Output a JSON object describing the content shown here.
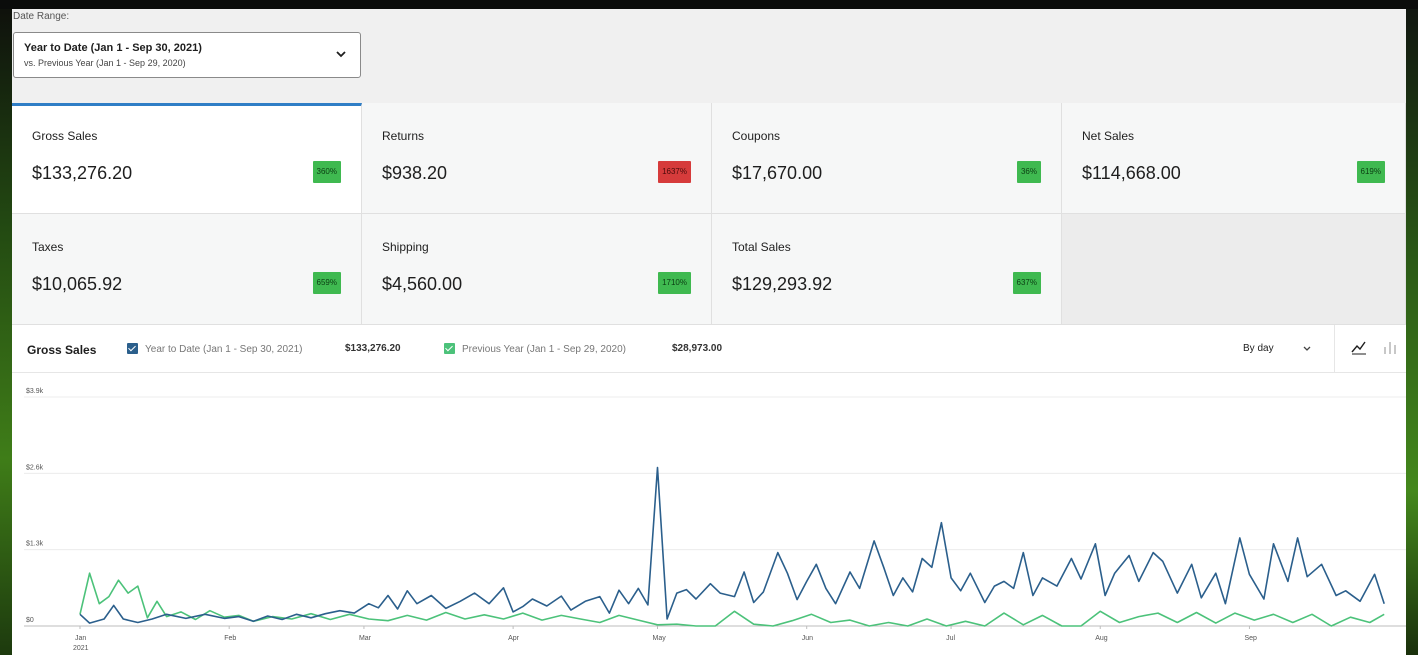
{
  "date_range": {
    "label": "Date Range:",
    "main": "Year to Date (Jan 1 - Sep 30, 2021)",
    "sub": "vs. Previous Year (Jan 1 - Sep 29, 2020)"
  },
  "cards": [
    {
      "label": "Gross Sales",
      "value": "$133,276.20",
      "change": "360%",
      "status": "up",
      "active": true
    },
    {
      "label": "Returns",
      "value": "$938.20",
      "change": "1637%",
      "status": "down"
    },
    {
      "label": "Coupons",
      "value": "$17,670.00",
      "change": "36%",
      "status": "up"
    },
    {
      "label": "Net Sales",
      "value": "$114,668.00",
      "change": "619%",
      "status": "up"
    },
    {
      "label": "Taxes",
      "value": "$10,065.92",
      "change": "659%",
      "status": "up"
    },
    {
      "label": "Shipping",
      "value": "$4,560.00",
      "change": "1710%",
      "status": "up"
    },
    {
      "label": "Total Sales",
      "value": "$129,293.92",
      "change": "637%",
      "status": "up"
    }
  ],
  "colors": {
    "accent": "#2f7ec6",
    "badge_up": "#3fb950",
    "badge_down": "#d63b3b",
    "series_current": "#2b5f8c",
    "series_previous": "#4cc27a"
  },
  "chart_header": {
    "title": "Gross Sales",
    "interval": "By day",
    "legend": [
      {
        "label": "Year to Date (Jan 1 - Sep 30, 2021)",
        "total": "$133,276.20",
        "checked": true
      },
      {
        "label": "Previous Year (Jan 1 - Sep 29, 2020)",
        "total": "$28,973.00",
        "checked": true
      }
    ],
    "icons": [
      "line-chart-icon",
      "bar-chart-icon"
    ]
  },
  "chart_data": {
    "type": "line",
    "y_ticks": [
      "$3.9k",
      "$2.6k",
      "$1.3k",
      "$0"
    ],
    "y_tick_values": [
      3900,
      2600,
      1300,
      0
    ],
    "ylim": [
      0,
      3900
    ],
    "x_ticks": [
      "Jan",
      "Feb",
      "Mar",
      "Apr",
      "May",
      "Jun",
      "Jul",
      "Aug",
      "Sep"
    ],
    "x_tick_sub": "2021",
    "x_tick_days": [
      0,
      31,
      59,
      90,
      120,
      151,
      181,
      212,
      243
    ],
    "x_max_day": 272,
    "grid": true,
    "series": [
      {
        "name": "Year to Date (Jan 1 - Sep 30, 2021)",
        "points": [
          [
            0,
            200
          ],
          [
            2,
            50
          ],
          [
            5,
            120
          ],
          [
            7,
            350
          ],
          [
            9,
            120
          ],
          [
            12,
            60
          ],
          [
            15,
            120
          ],
          [
            18,
            200
          ],
          [
            22,
            130
          ],
          [
            26,
            200
          ],
          [
            30,
            130
          ],
          [
            33,
            160
          ],
          [
            36,
            80
          ],
          [
            39,
            170
          ],
          [
            42,
            110
          ],
          [
            45,
            200
          ],
          [
            48,
            140
          ],
          [
            51,
            210
          ],
          [
            54,
            260
          ],
          [
            57,
            220
          ],
          [
            60,
            380
          ],
          [
            62,
            310
          ],
          [
            64,
            520
          ],
          [
            66,
            290
          ],
          [
            68,
            600
          ],
          [
            70,
            380
          ],
          [
            73,
            520
          ],
          [
            76,
            300
          ],
          [
            79,
            420
          ],
          [
            82,
            560
          ],
          [
            85,
            380
          ],
          [
            88,
            650
          ],
          [
            90,
            240
          ],
          [
            92,
            330
          ],
          [
            94,
            460
          ],
          [
            97,
            340
          ],
          [
            100,
            510
          ],
          [
            102,
            270
          ],
          [
            105,
            420
          ],
          [
            108,
            500
          ],
          [
            110,
            220
          ],
          [
            112,
            610
          ],
          [
            114,
            380
          ],
          [
            116,
            640
          ],
          [
            118,
            360
          ],
          [
            120,
            2700
          ],
          [
            122,
            120
          ],
          [
            124,
            560
          ],
          [
            126,
            620
          ],
          [
            128,
            460
          ],
          [
            131,
            720
          ],
          [
            133,
            560
          ],
          [
            136,
            500
          ],
          [
            138,
            920
          ],
          [
            140,
            400
          ],
          [
            142,
            580
          ],
          [
            145,
            1250
          ],
          [
            147,
            900
          ],
          [
            149,
            450
          ],
          [
            151,
            760
          ],
          [
            153,
            1050
          ],
          [
            155,
            640
          ],
          [
            157,
            380
          ],
          [
            160,
            920
          ],
          [
            162,
            640
          ],
          [
            165,
            1450
          ],
          [
            167,
            1000
          ],
          [
            169,
            520
          ],
          [
            171,
            820
          ],
          [
            173,
            580
          ],
          [
            175,
            1150
          ],
          [
            177,
            1000
          ],
          [
            179,
            1760
          ],
          [
            181,
            820
          ],
          [
            183,
            600
          ],
          [
            185,
            900
          ],
          [
            188,
            400
          ],
          [
            190,
            680
          ],
          [
            192,
            760
          ],
          [
            194,
            640
          ],
          [
            196,
            1250
          ],
          [
            198,
            520
          ],
          [
            200,
            820
          ],
          [
            203,
            680
          ],
          [
            206,
            1150
          ],
          [
            208,
            800
          ],
          [
            211,
            1400
          ],
          [
            213,
            520
          ],
          [
            215,
            900
          ],
          [
            218,
            1200
          ],
          [
            220,
            760
          ],
          [
            223,
            1250
          ],
          [
            225,
            1100
          ],
          [
            228,
            560
          ],
          [
            231,
            1050
          ],
          [
            233,
            480
          ],
          [
            236,
            900
          ],
          [
            238,
            380
          ],
          [
            241,
            1500
          ],
          [
            243,
            880
          ],
          [
            246,
            460
          ],
          [
            248,
            1400
          ],
          [
            251,
            760
          ],
          [
            253,
            1500
          ],
          [
            255,
            840
          ],
          [
            258,
            1050
          ],
          [
            261,
            520
          ],
          [
            263,
            600
          ],
          [
            266,
            420
          ],
          [
            269,
            880
          ],
          [
            271,
            380
          ]
        ]
      },
      {
        "name": "Previous Year (Jan 1 - Sep 29, 2020)",
        "points": [
          [
            0,
            200
          ],
          [
            2,
            900
          ],
          [
            4,
            380
          ],
          [
            6,
            500
          ],
          [
            8,
            780
          ],
          [
            10,
            560
          ],
          [
            12,
            680
          ],
          [
            14,
            140
          ],
          [
            16,
            420
          ],
          [
            18,
            160
          ],
          [
            21,
            240
          ],
          [
            24,
            110
          ],
          [
            27,
            260
          ],
          [
            30,
            150
          ],
          [
            33,
            180
          ],
          [
            36,
            80
          ],
          [
            40,
            160
          ],
          [
            44,
            120
          ],
          [
            48,
            210
          ],
          [
            52,
            110
          ],
          [
            56,
            200
          ],
          [
            60,
            120
          ],
          [
            64,
            90
          ],
          [
            68,
            180
          ],
          [
            72,
            100
          ],
          [
            76,
            230
          ],
          [
            80,
            120
          ],
          [
            84,
            190
          ],
          [
            88,
            120
          ],
          [
            92,
            220
          ],
          [
            96,
            100
          ],
          [
            100,
            180
          ],
          [
            104,
            120
          ],
          [
            108,
            60
          ],
          [
            112,
            180
          ],
          [
            116,
            100
          ],
          [
            120,
            20
          ],
          [
            124,
            30
          ],
          [
            128,
            0
          ],
          [
            132,
            0
          ],
          [
            136,
            250
          ],
          [
            140,
            30
          ],
          [
            144,
            0
          ],
          [
            148,
            90
          ],
          [
            152,
            200
          ],
          [
            156,
            60
          ],
          [
            160,
            100
          ],
          [
            164,
            0
          ],
          [
            168,
            60
          ],
          [
            172,
            0
          ],
          [
            176,
            120
          ],
          [
            180,
            0
          ],
          [
            184,
            80
          ],
          [
            188,
            0
          ],
          [
            192,
            220
          ],
          [
            196,
            20
          ],
          [
            200,
            180
          ],
          [
            204,
            0
          ],
          [
            208,
            0
          ],
          [
            212,
            250
          ],
          [
            216,
            60
          ],
          [
            220,
            160
          ],
          [
            224,
            220
          ],
          [
            228,
            60
          ],
          [
            232,
            230
          ],
          [
            236,
            50
          ],
          [
            240,
            220
          ],
          [
            244,
            100
          ],
          [
            248,
            200
          ],
          [
            252,
            60
          ],
          [
            256,
            200
          ],
          [
            260,
            0
          ],
          [
            264,
            150
          ],
          [
            268,
            60
          ],
          [
            271,
            200
          ]
        ]
      }
    ]
  }
}
